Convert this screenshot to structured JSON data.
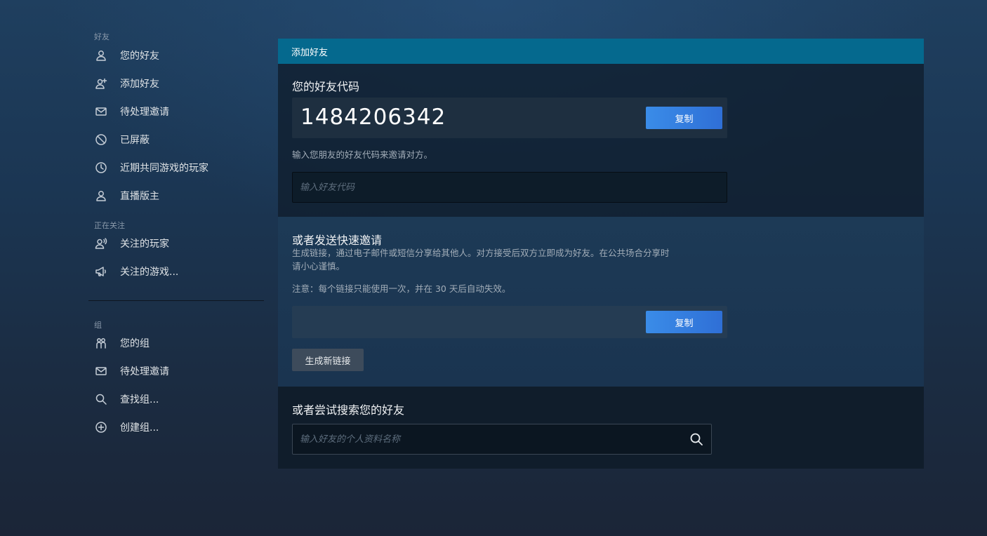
{
  "sidebar": {
    "sections": [
      {
        "label": "好友",
        "items": [
          {
            "label": "您的好友",
            "icon": "person-icon"
          },
          {
            "label": "添加好友",
            "icon": "add-person-icon"
          },
          {
            "label": "待处理邀请",
            "icon": "envelope-icon"
          },
          {
            "label": "已屏蔽",
            "icon": "blocked-icon"
          },
          {
            "label": "近期共同游戏的玩家",
            "icon": "clock-icon"
          },
          {
            "label": "直播版主",
            "icon": "person-icon"
          }
        ]
      },
      {
        "label": "正在关注",
        "items": [
          {
            "label": "关注的玩家",
            "icon": "person-broadcast-icon"
          },
          {
            "label": "关注的游戏...",
            "icon": "megaphone-icon"
          }
        ]
      },
      {
        "label": "组",
        "items": [
          {
            "label": "您的组",
            "icon": "group-icon"
          },
          {
            "label": "待处理邀请",
            "icon": "envelope-icon"
          },
          {
            "label": "查找组...",
            "icon": "search-icon"
          },
          {
            "label": "创建组...",
            "icon": "plus-circle-icon"
          }
        ]
      }
    ]
  },
  "panel": {
    "header": "添加好友",
    "friend_code": {
      "title": "您的好友代码",
      "code": "1484206342",
      "copy_label": "复制",
      "hint": "输入您朋友的好友代码来邀请对方。",
      "input_placeholder": "输入好友代码",
      "input_value": ""
    },
    "quick_invite": {
      "title": "或者发送快速邀请",
      "description_line1": "生成链接，通过电子邮件或短信分享给其他人。对方接受后双方立即成为好友。在公共场合分享时",
      "description_line2": "请小心谨慎。",
      "note": "注意：每个链接只能使用一次，并在 30 天后自动失效。",
      "link_value": "",
      "copy_label": "复制",
      "generate_label": "生成新链接"
    },
    "search": {
      "title": "或者尝试搜索您的好友",
      "placeholder": "输入好友的个人资料名称",
      "value": ""
    }
  },
  "colors": {
    "header_bg": "#05698e",
    "button_blue": "#3a8ce8",
    "button_gray": "#3d4b5b"
  }
}
